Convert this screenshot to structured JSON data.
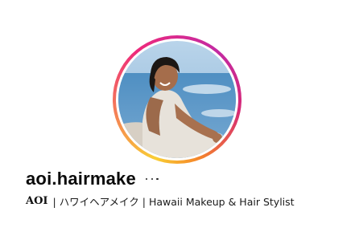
{
  "profile": {
    "username": "aoi.hairmake",
    "display_name": "AOI",
    "bio": "| ハワイヘアメイク | Hawaii Makeup & Hair Stylist",
    "more_options_icon": "more-horizontal-icon",
    "story_ring_colors": [
      "#f9ce34",
      "#ee2a7b",
      "#c32aa3",
      "#d62976",
      "#f58529"
    ]
  }
}
